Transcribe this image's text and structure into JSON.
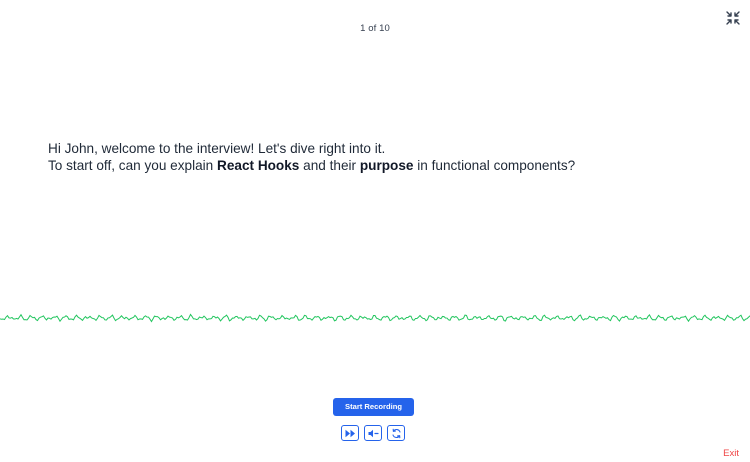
{
  "progress": {
    "label": "1 of 10"
  },
  "question": {
    "line1": "Hi John, welcome to the interview! Let's dive right into it.",
    "line2_part1": "To start off, can you explain ",
    "line2_bold1": "React Hooks",
    "line2_part2": " and their ",
    "line2_bold2": "purpose",
    "line2_part3": " in functional components?"
  },
  "actions": {
    "start_recording": "Start Recording",
    "exit": "Exit"
  },
  "icons": {
    "collapse": "collapse-icon",
    "skip": "fast-forward-icon",
    "mute": "volume-mute-icon",
    "retry": "refresh-icon"
  },
  "colors": {
    "primary": "#2563eb",
    "waveform": "#22c55e",
    "exit": "#ef4444",
    "text": "#1f2937"
  }
}
